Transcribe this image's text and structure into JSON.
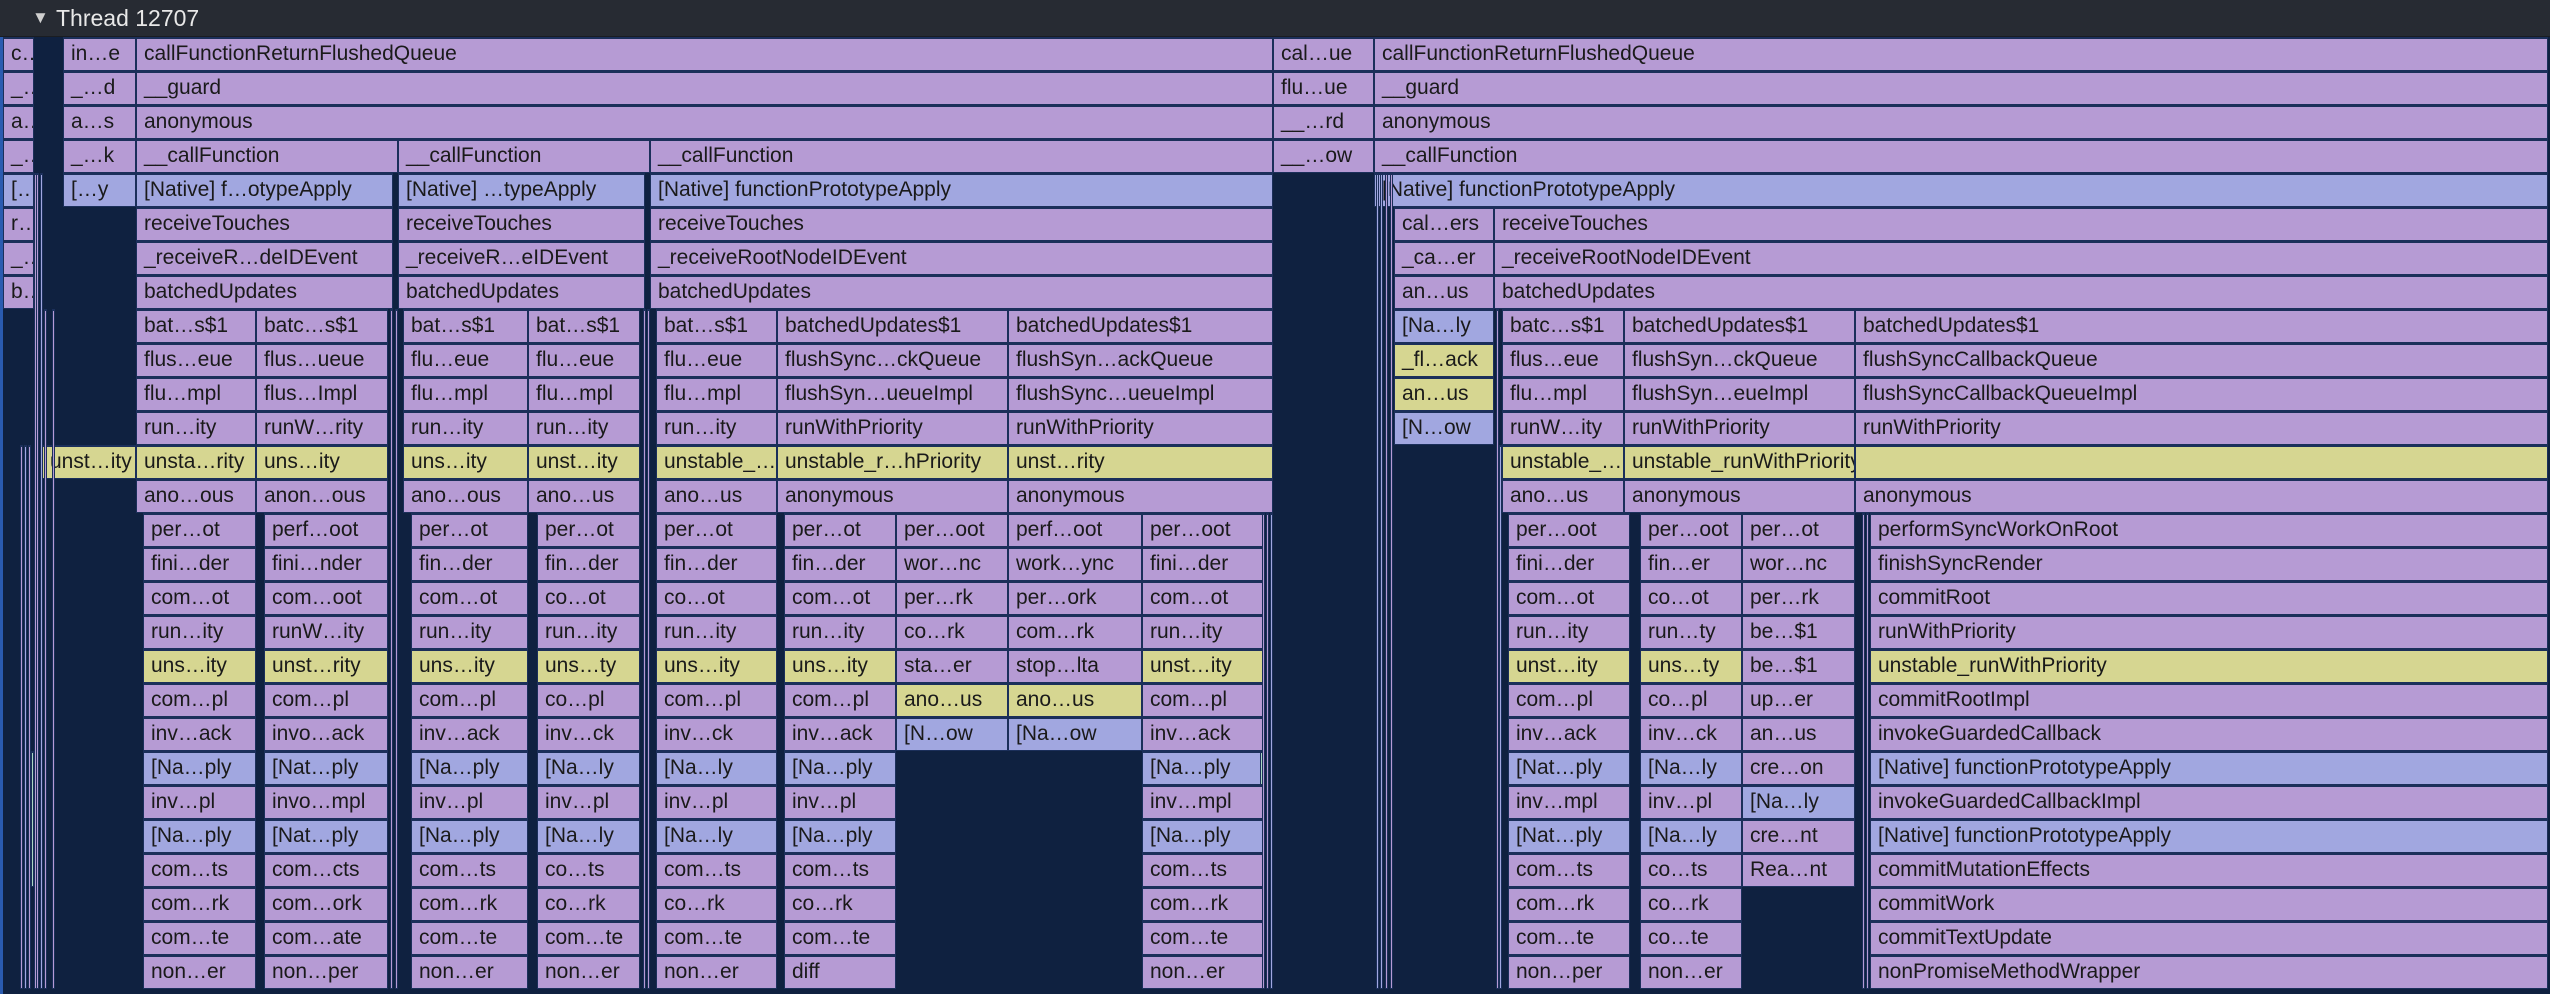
{
  "header": {
    "collapse_icon": "triangle-down-icon",
    "title": "Thread 12707"
  },
  "rows": [
    [
      "c…",
      "in…e",
      "callFunctionReturnFlushedQueue",
      "cal…ue",
      "callFunctionReturnFlushedQueue"
    ],
    [
      "_…",
      "_…d",
      "__guard",
      "flu…ue",
      "__guard"
    ],
    [
      "a…",
      "a…s",
      "anonymous",
      "__…rd",
      "anonymous"
    ],
    [
      "_…",
      "_…k",
      "__callFunction",
      "__callFunction",
      "__callFunction",
      "__…ow",
      "__callFunction"
    ],
    [
      "[…y",
      "[…y",
      "[Native] f…otypeApply",
      "[Native] …typeApply",
      "[Native] functionPrototypeApply",
      "[Native] functionPrototypeApply"
    ],
    [
      "r…",
      "receiveTouches",
      "receiveTouches",
      "receiveTouches",
      "cal…ers",
      "receiveTouches"
    ],
    [
      "_…t",
      "_receiveR…deIDEvent",
      "_receiveR…eIDEvent",
      "_receiveRootNodeIDEvent",
      "_ca…er",
      "_receiveRootNodeIDEvent"
    ],
    [
      "b…",
      "batchedUpdates",
      "batchedUpdates",
      "batchedUpdates",
      "an…us",
      "batchedUpdates"
    ],
    [
      "bat…s$1",
      "batc…s$1",
      "bat…s$1",
      "bat…s$1",
      "bat…s$1",
      "batchedUpdates$1",
      "batchedUpdates$1",
      "[Na…ly",
      "batc…s$1",
      "batchedUpdates$1",
      "batchedUpdates$1"
    ],
    [
      "flus…eue",
      "flus…ueue",
      "flu…eue",
      "flu…eue",
      "flu…eue",
      "flushSync…ckQueue",
      "flushSyn…ackQueue",
      "_fl…ack",
      "flus…eue",
      "flushSyn…ckQueue",
      "flushSyncCallbackQueue"
    ],
    [
      "flu…mpl",
      "flus…Impl",
      "flu…mpl",
      "flu…mpl",
      "flu…mpl",
      "flushSyn…ueueImpl",
      "flushSync…ueueImpl",
      "an…us",
      "flu…mpl",
      "flushSyn…eueImpl",
      "flushSyncCallbackQueueImpl"
    ],
    [
      "run…ity",
      "runW…rity",
      "run…ity",
      "run…ity",
      "run…ity",
      "runWithPriority",
      "runWithPriority",
      "[N…ow",
      "runW…ity",
      "runWithPriority",
      "runWithPriority"
    ],
    [
      "unst…ity",
      "unsta…rity",
      "uns…ity",
      "uns…ity",
      "unst…ity",
      "unstable_…Priority",
      "unstable_r…hPriority",
      "unst…rity",
      "unstable_…Priority",
      "unstable_runWithPriority"
    ],
    [
      "ano…ous",
      "anon…ous",
      "ano…ous",
      "ano…us",
      "ano…us",
      "anonymous",
      "anonymous",
      "ano…us",
      "anonymous",
      "anonymous"
    ],
    [
      "per…ot",
      "perf…oot",
      "per…ot",
      "per…ot",
      "per…ot",
      "per…ot",
      "per…oot",
      "perf…oot",
      "per…oot",
      "per…oot",
      "per…oot",
      "per…ot",
      "performSyncWorkOnRoot"
    ],
    [
      "fini…der",
      "fini…nder",
      "fin…der",
      "fin…der",
      "fin…der",
      "fin…der",
      "wor…nc",
      "work…ync",
      "fini…der",
      "fini…der",
      "fin…er",
      "wor…nc",
      "finishSyncRender"
    ],
    [
      "com…ot",
      "com…oot",
      "com…ot",
      "co…ot",
      "co…ot",
      "com…ot",
      "per…rk",
      "per…ork",
      "com…ot",
      "com…ot",
      "co…ot",
      "per…rk",
      "commitRoot"
    ],
    [
      "run…ity",
      "runW…ity",
      "run…ity",
      "run…ity",
      "run…ity",
      "run…ity",
      "co…rk",
      "com…rk",
      "run…ity",
      "run…ity",
      "run…ty",
      "be…$1",
      "runWithPriority"
    ],
    [
      "uns…ity",
      "unst…rity",
      "uns…ity",
      "uns…ty",
      "uns…ity",
      "uns…ity",
      "sta…er",
      "stop…lta",
      "unst…ity",
      "unst…ity",
      "uns…ty",
      "be…$1",
      "unstable_runWithPriority"
    ],
    [
      "com…pl",
      "com…pl",
      "com…pl",
      "co…pl",
      "com…pl",
      "com…pl",
      "ano…us",
      "ano…us",
      "com…pl",
      "com…pl",
      "co…pl",
      "up…er",
      "commitRootImpl"
    ],
    [
      "inv…ack",
      "invo…ack",
      "inv…ack",
      "inv…ck",
      "inv…ck",
      "inv…ack",
      "[N…ow",
      "[Na…ow",
      "inv…ack",
      "inv…ack",
      "inv…ck",
      "an…us",
      "invokeGuardedCallback"
    ],
    [
      "[Na…ply",
      "[Nat…ply",
      "[Na…ply",
      "[Na…ly",
      "[Na…ly",
      "[Na…ply",
      "[Na…ply",
      "[Nat…ply",
      "[Na…ly",
      "cre…on",
      "[Native] functionPrototypeApply"
    ],
    [
      "inv…pl",
      "invo…mpl",
      "inv…pl",
      "inv…pl",
      "inv…pl",
      "inv…pl",
      "inv…mpl",
      "inv…mpl",
      "inv…pl",
      "[Na…ly",
      "invokeGuardedCallbackImpl"
    ],
    [
      "[Na…ply",
      "[Nat…ply",
      "[Na…ply",
      "[Na…ly",
      "[Na…ly",
      "[Na…ply",
      "[Na…ply",
      "[Nat…ply",
      "[Na…ly",
      "cre…nt",
      "[Native] functionPrototypeApply"
    ],
    [
      "com…ts",
      "com…cts",
      "com…ts",
      "co…ts",
      "com…ts",
      "com…ts",
      "com…ts",
      "com…ts",
      "co…ts",
      "Rea…nt",
      "commitMutationEffects"
    ],
    [
      "com…rk",
      "com…ork",
      "com…rk",
      "co…rk",
      "co…rk",
      "co…rk",
      "com…rk",
      "com…rk",
      "co…rk",
      "commitWork"
    ],
    [
      "com…te",
      "com…ate",
      "com…te",
      "com…te",
      "com…te",
      "com…te",
      "com…te",
      "com…te",
      "co…te",
      "commitTextUpdate"
    ],
    [
      "non…er",
      "non…per",
      "non…er",
      "non…er",
      "non…er",
      "diff",
      "non…er",
      "non…per",
      "non…er",
      "nonPromiseMethodWrapper"
    ]
  ]
}
